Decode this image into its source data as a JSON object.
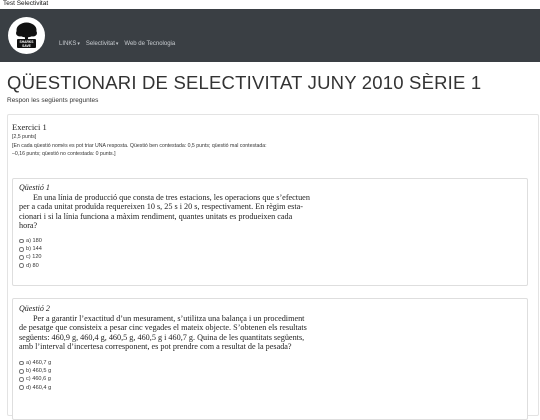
{
  "window": {
    "title": "Test Selectivitat"
  },
  "navbar": {
    "logo_text": "SHARKS\nSAVE",
    "items": [
      {
        "label": "LINKS",
        "has_caret": true
      },
      {
        "label": "Selectivitat",
        "has_caret": true
      },
      {
        "label": "Web de Tecnologia",
        "has_caret": false
      }
    ],
    "caret": "▾"
  },
  "page": {
    "title": "QÜESTIONARI DE SELECTIVITAT JUNY 2010 SÈRIE 1",
    "subtitle": "Respon les següents preguntes"
  },
  "exercise": {
    "title": "Exercici 1",
    "points": "[2,5 punts]",
    "note_1": "[En cada qüestió només es pot triar UNA resposta. Qüestió ben contestada: 0,5 punts; qüestió mal contestada:",
    "note_2": "–0,16 punts; qüestió no contestada: 0 punts.]"
  },
  "questions": [
    {
      "title": "Qüestió 1",
      "lines": [
        "En una línia de producció que consta de tres estacions, les operacions que s’efectuen",
        "per a cada unitat produïda requereixen 10 s, 25 s i 20 s, respectivament. En règim esta-",
        "cionari i si la línia funciona a màxim rendiment, quantes unitats es produeixen cada",
        "hora?"
      ],
      "options": [
        "a) 180",
        "b) 144",
        "c) 120",
        "d) 80"
      ]
    },
    {
      "title": "Qüestió 2",
      "lines": [
        "Per a garantir l’exactitud d’un mesurament, s’utilitza una balança i un procediment",
        "de pesatge que consisteix a pesar cinc vegades el mateix objecte. S’obtenen els resultats",
        "següents: 460,9 g, 460,4 g, 460,5 g, 460,5 g i 460,7 g. Quina de les quantitats següents,",
        "amb l’interval d’incertesa corresponent, es pot prendre com a resultat de la pesada?"
      ],
      "options": [
        "a) 460,7 g",
        "b) 460,5 g",
        "c) 460,6 g",
        "d) 460,4 g"
      ]
    }
  ]
}
